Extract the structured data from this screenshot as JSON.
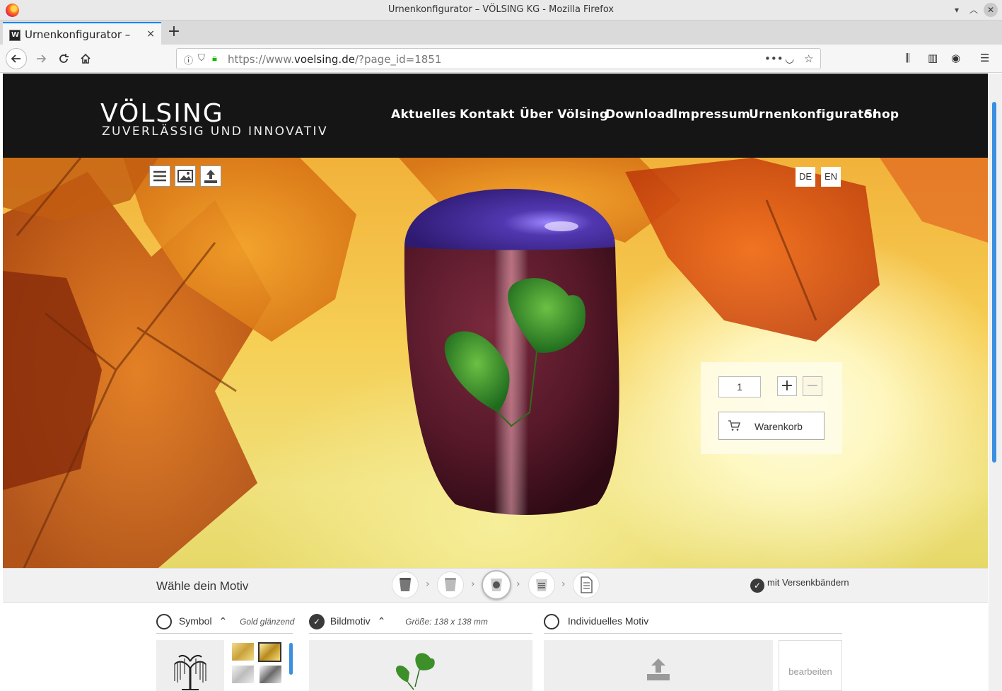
{
  "window": {
    "title": "Urnenkonfigurator – VÖLSING KG - Mozilla Firefox"
  },
  "tab": {
    "title": "Urnenkonfigurator –",
    "close": "×",
    "new": "+"
  },
  "urlbar": {
    "prefix": "https://www.",
    "domain": "voelsing.de",
    "path": "/?page_id=1851"
  },
  "site": {
    "logo": "VÖLSING",
    "tagline": "ZUVERLÄSSIG UND INNOVATIV",
    "menu": [
      "Aktuelles",
      "Kontakt",
      "Über Völsing",
      "Download",
      "Impressum",
      "Urnenkonfigurator",
      "Shop"
    ]
  },
  "hero": {
    "lang": [
      "DE",
      "EN"
    ],
    "quantity": "1",
    "cart_label": "Warenkorb"
  },
  "steps": {
    "title": "Wähle dein Motiv",
    "versand_label": "mit Versenkbändern",
    "arrow": "›"
  },
  "options": {
    "symbol": {
      "label": "Symbol",
      "sub": "Gold glänzend"
    },
    "bildmotiv": {
      "label": "Bildmotiv",
      "sub": "Größe:  138 x 138 mm"
    },
    "individuell": {
      "label": "Individuelles Motiv"
    },
    "edit_label": "bearbeiten"
  },
  "colors": {
    "accent": "#0a84ff",
    "header_bg": "#151515",
    "urn_body": "#5a1a2a",
    "urn_lid": "#4a3599"
  }
}
